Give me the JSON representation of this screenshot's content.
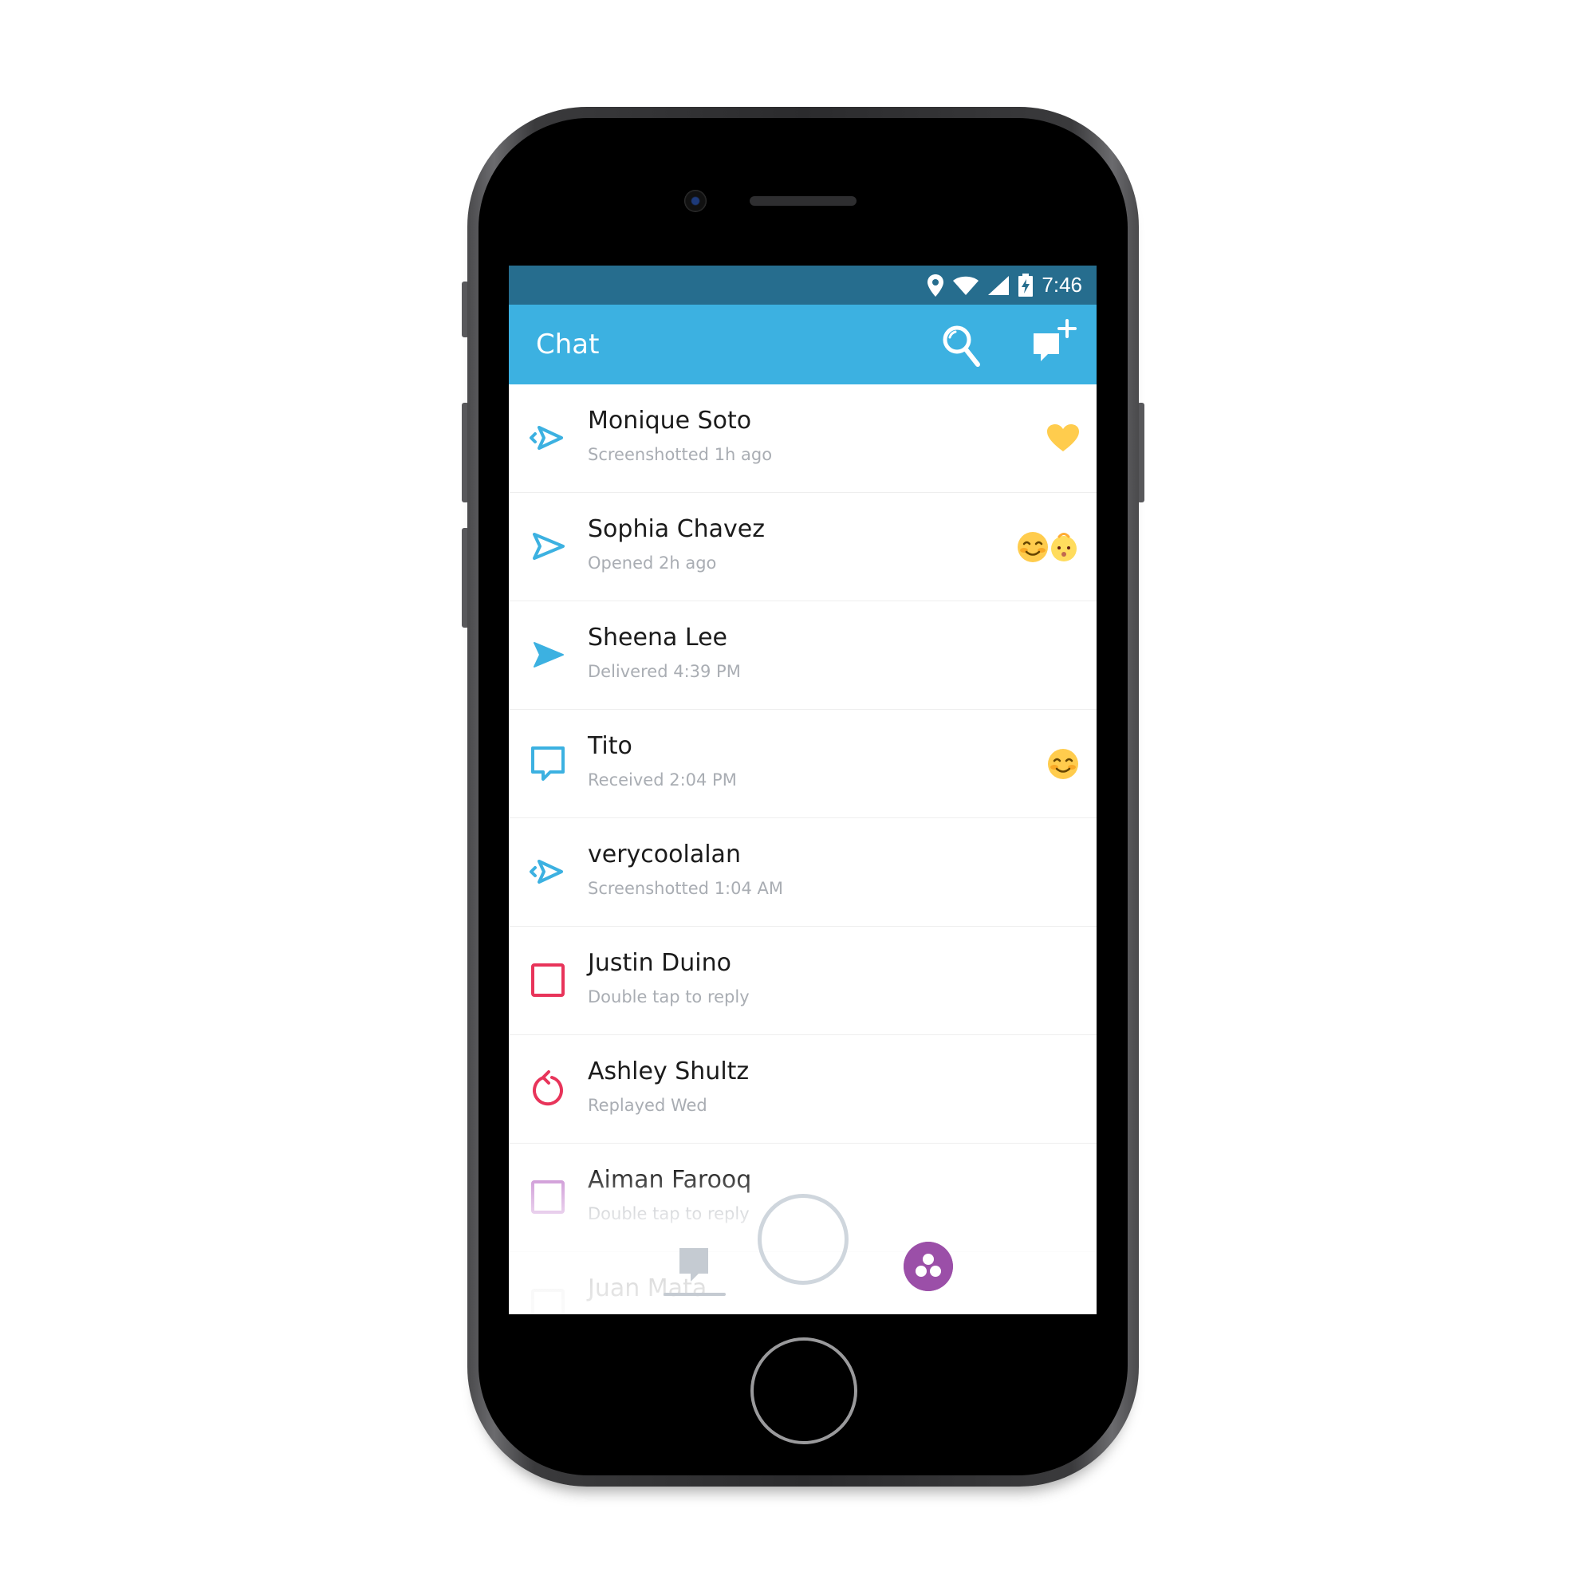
{
  "status_bar": {
    "time": "7:46",
    "icons": [
      "location-icon",
      "wifi-icon",
      "signal-icon",
      "battery-charging-icon"
    ]
  },
  "app_bar": {
    "title": "Chat",
    "actions": [
      "search-icon",
      "new-chat-icon"
    ]
  },
  "chats": [
    {
      "name": "Monique Soto",
      "status": "Screenshotted 1h ago",
      "icon": "screenshot-arrow-icon",
      "icon_color": "#3cb1e1",
      "emoji": [
        "yellow-heart-emoji"
      ]
    },
    {
      "name": "Sophia Chavez",
      "status": "Opened 2h ago",
      "icon": "opened-arrow-icon",
      "icon_color": "#3cb1e1",
      "emoji": [
        "smiling-face-emoji",
        "baby-emoji"
      ]
    },
    {
      "name": "Sheena Lee",
      "status": "Delivered 4:39 PM",
      "icon": "delivered-arrow-icon",
      "icon_color": "#3cb1e1",
      "emoji": []
    },
    {
      "name": "Tito",
      "status": "Received 2:04 PM",
      "icon": "chat-bubble-icon",
      "icon_color": "#3cb1e1",
      "emoji": [
        "smiling-face-emoji"
      ]
    },
    {
      "name": "verycoolalan",
      "status": "Screenshotted 1:04 AM",
      "icon": "screenshot-arrow-icon",
      "icon_color": "#3cb1e1",
      "emoji": []
    },
    {
      "name": "Justin Duino",
      "status": "Double tap to reply",
      "icon": "unopened-snap-square-icon",
      "icon_color": "#e8345a",
      "emoji": []
    },
    {
      "name": "Ashley Shultz",
      "status": "Replayed Wed",
      "icon": "replay-icon",
      "icon_color": "#e8345a",
      "emoji": []
    },
    {
      "name": "Aiman Farooq",
      "status": "Double tap to reply",
      "icon": "unopened-video-square-icon",
      "icon_color": "#c98dd2",
      "emoji": []
    },
    {
      "name": "Juan Mata",
      "status": "",
      "icon": "unopened-square-icon",
      "icon_color": "#cccccc",
      "emoji": []
    }
  ],
  "bottom_nav": {
    "items": [
      "chat-nav-icon",
      "camera-shutter-button",
      "stories-icon"
    ]
  },
  "colors": {
    "status_bar": "#266d8e",
    "app_bar": "#3cb1e1",
    "snap_red": "#e8345a",
    "video_purple": "#c98dd2",
    "stories_purple": "#9b4fa8"
  }
}
